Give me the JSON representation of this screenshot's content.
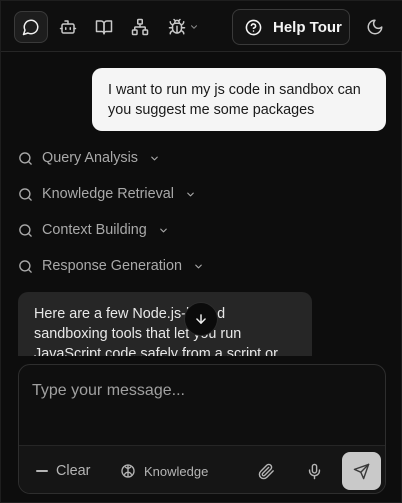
{
  "toolbar": {
    "help_tour_label": "Help Tour",
    "icons": [
      "chat-icon",
      "bot-icon",
      "book-icon",
      "sitemap-icon",
      "bug-icon",
      "help-circle-icon",
      "moon-icon"
    ]
  },
  "chat": {
    "user_message": "I want to run my js code in sandbox can you suggest me some packages",
    "steps": [
      {
        "label": "Query Analysis"
      },
      {
        "label": "Knowledge Retrieval"
      },
      {
        "label": "Context Building"
      },
      {
        "label": "Response Generation"
      }
    ],
    "assistant_message": "Here are a few Node.js-based sandboxing tools that let you run JavaScript code safely from a script or"
  },
  "composer": {
    "placeholder": "Type your message...",
    "clear_label": "Clear",
    "knowledge_label": "Knowledge"
  },
  "colors": {
    "background": "#0d0d0d",
    "user_bubble": "#f5f5f5",
    "assistant_bubble": "#262626",
    "send_button": "#c9c9c9"
  }
}
